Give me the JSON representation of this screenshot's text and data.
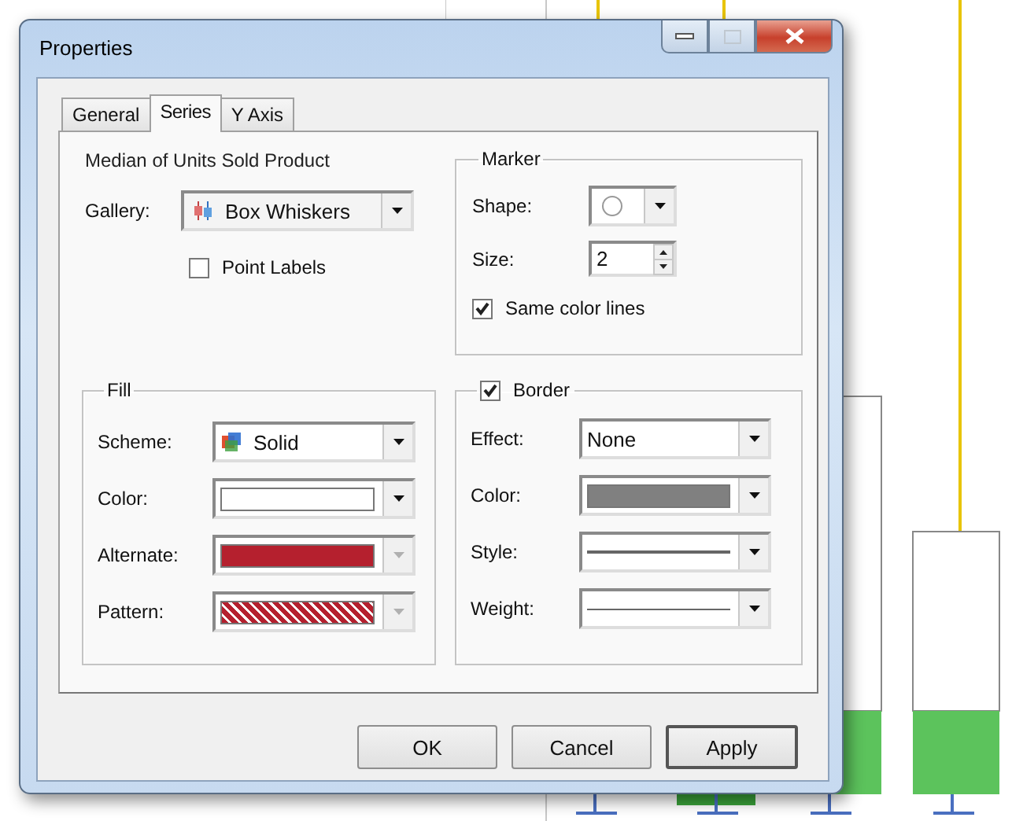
{
  "window": {
    "title": "Properties"
  },
  "tabs": [
    {
      "label": "General",
      "selected": false
    },
    {
      "label": "Series",
      "selected": true
    },
    {
      "label": "Y Axis",
      "selected": false
    }
  ],
  "series_name": "Median of Units Sold Product",
  "gallery": {
    "label": "Gallery:",
    "value": "Box Whiskers"
  },
  "point_labels": {
    "label": "Point Labels",
    "checked": false
  },
  "marker": {
    "title": "Marker",
    "shape": {
      "label": "Shape:"
    },
    "size": {
      "label": "Size:",
      "value": "2"
    },
    "same_color_lines": {
      "label": "Same color lines",
      "checked": true
    }
  },
  "fill": {
    "title": "Fill",
    "fields": [
      {
        "label": "Scheme:",
        "kind": "icon_text",
        "value": "Solid",
        "disabled": false
      },
      {
        "label": "Color:",
        "kind": "swatch",
        "color": "#ffffff",
        "disabled": false
      },
      {
        "label": "Alternate:",
        "kind": "swatch",
        "color": "#b5202e",
        "disabled": true
      },
      {
        "label": "Pattern:",
        "kind": "pattern",
        "color": "#b5202e",
        "disabled": true
      }
    ]
  },
  "border": {
    "title": "Border",
    "checked": true,
    "fields": [
      {
        "label": "Effect:",
        "kind": "text",
        "value": "None",
        "disabled": false
      },
      {
        "label": "Color:",
        "kind": "swatch",
        "color": "#808080",
        "disabled": false
      },
      {
        "label": "Style:",
        "kind": "line",
        "disabled": false
      },
      {
        "label": "Weight:",
        "kind": "line",
        "disabled": false
      }
    ]
  },
  "buttons": [
    {
      "label": "OK",
      "focused": false
    },
    {
      "label": "Cancel",
      "focused": false
    },
    {
      "label": "Apply",
      "focused": true
    }
  ]
}
